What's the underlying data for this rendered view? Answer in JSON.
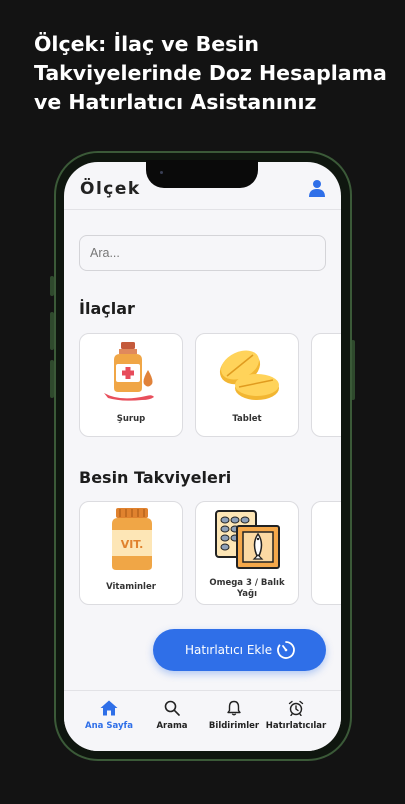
{
  "headline": "Ölçek: İlaç ve Besin Takviyelerinde Doz Hesaplama ve Hatırlatıcı Asistanınız",
  "app": {
    "title": "Ölçek",
    "search_placeholder": "Ara..."
  },
  "sections": {
    "medicines": {
      "title": "İlaçlar",
      "items": [
        {
          "label": "Şurup",
          "icon": "syrup-bottle-icon"
        },
        {
          "label": "Tablet",
          "icon": "tablet-pills-icon"
        }
      ]
    },
    "supplements": {
      "title": "Besin Takviyeleri",
      "items": [
        {
          "label": "Vitaminler",
          "icon": "vitamin-jar-icon",
          "jar_text": "VIT."
        },
        {
          "label": "Omega 3 / Balık Yağı",
          "icon": "omega3-fish-oil-icon"
        }
      ]
    }
  },
  "reminder_button": {
    "label": "Hatırlatıcı Ekle",
    "icon": "timer-icon"
  },
  "tabbar": {
    "items": [
      {
        "label": "Ana Sayfa",
        "icon": "home-icon",
        "active": true
      },
      {
        "label": "Arama",
        "icon": "search-icon",
        "active": false
      },
      {
        "label": "Bildirimler",
        "icon": "bell-icon",
        "active": false
      },
      {
        "label": "Hatırlatıcılar",
        "icon": "alarm-clock-icon",
        "active": false
      }
    ]
  },
  "colors": {
    "accent": "#2f6fe8",
    "background": "#131313",
    "screen": "#f6f6f9",
    "frame": "#3b5a38"
  }
}
